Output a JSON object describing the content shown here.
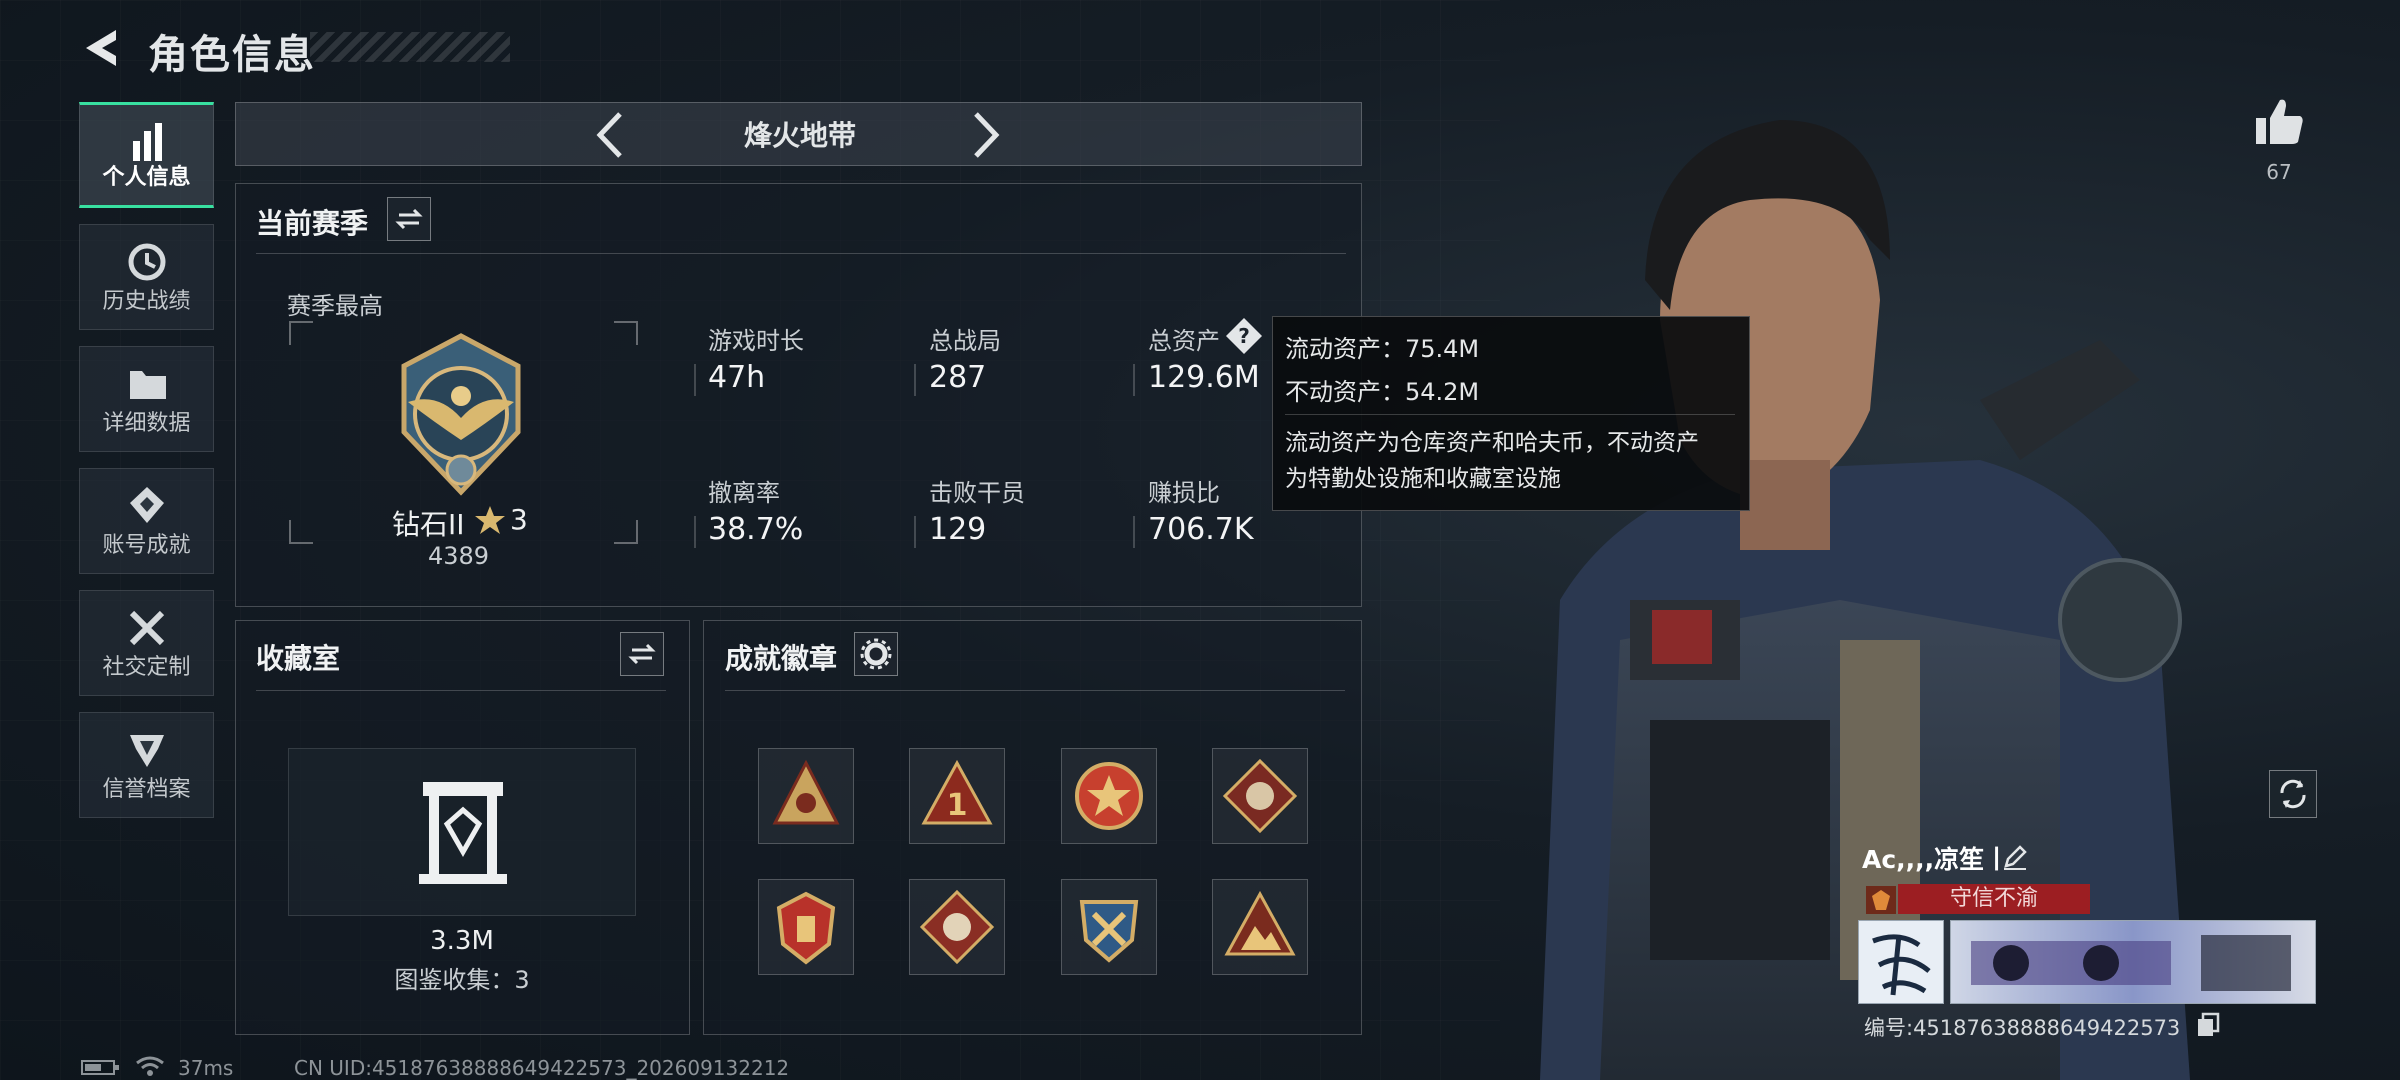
{
  "header": {
    "title": "角色信息"
  },
  "sidebar": {
    "items": [
      {
        "label": "个人信息",
        "icon": "bar-chart-icon"
      },
      {
        "label": "历史战绩",
        "icon": "history-clock-icon"
      },
      {
        "label": "详细数据",
        "icon": "folder-icon"
      },
      {
        "label": "账号成就",
        "icon": "achievement-badge-icon"
      },
      {
        "label": "社交定制",
        "icon": "tools-wrench-icon"
      },
      {
        "label": "信誉档案",
        "icon": "reputation-shield-icon"
      }
    ]
  },
  "mode_switcher": {
    "title": "烽火地带"
  },
  "season": {
    "header": "当前赛季",
    "best_label": "赛季最高",
    "rank_name": "钻石II",
    "rank_stars": "3",
    "rank_score": "4389",
    "stats": [
      {
        "label": "游戏时长",
        "value": "47h"
      },
      {
        "label": "总战局",
        "value": "287"
      },
      {
        "label": "总资产",
        "value": "129.6M"
      },
      {
        "label": "撤离率",
        "value": "38.7%"
      },
      {
        "label": "击败干员",
        "value": "129"
      },
      {
        "label": "赚损比",
        "value": "706.7K"
      }
    ]
  },
  "tooltip": {
    "liquid": "流动资产：75.4M",
    "fixed": "不动资产：54.2M",
    "desc1": "流动资产为仓库资产和哈夫币，不动资产",
    "desc2": "为特勤处设施和收藏室设施"
  },
  "collection": {
    "header": "收藏室",
    "value": "3.3M",
    "catalog": "图鉴收集：3"
  },
  "achievements": {
    "header": "成就徽章"
  },
  "likes": {
    "count": "67"
  },
  "player": {
    "name": "Ac,,,,凉笙丨",
    "title_badge": "守信不渝",
    "id_label": "编号:451876388886494225​73"
  },
  "status": {
    "ping": "37ms",
    "uid": "CN UID:451876388886494225​73_202609132212"
  },
  "colors": {
    "accent": "#38e0a0",
    "badge_red": "#9c1e22"
  }
}
